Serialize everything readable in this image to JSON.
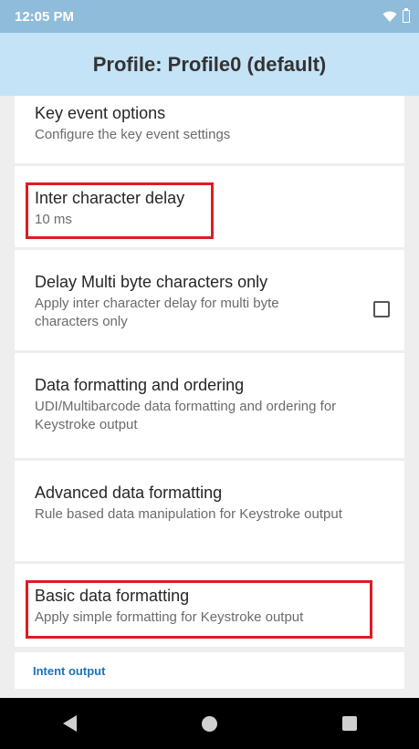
{
  "status_bar": {
    "time": "12:05 PM",
    "icons": [
      "wifi-icon",
      "battery-icon"
    ]
  },
  "app_bar": {
    "title": "Profile: Profile0 (default)"
  },
  "settings": {
    "items": [
      {
        "title": "Key event options",
        "subtitle": "Configure the key event settings"
      },
      {
        "title": "Inter character delay",
        "subtitle": "10 ms"
      },
      {
        "title": "Delay Multi byte characters only",
        "subtitle": "Apply inter character delay for multi byte characters only",
        "checked": false
      },
      {
        "title": "Data formatting and ordering",
        "subtitle": "UDI/Multibarcode data formatting and ordering for Keystroke output"
      },
      {
        "title": "Advanced data formatting",
        "subtitle": "Rule based data manipulation for Keystroke output"
      },
      {
        "title": "Basic data formatting",
        "subtitle": "Apply simple formatting for Keystroke output"
      }
    ],
    "section_header": "Intent output"
  },
  "colors": {
    "status_bar": "#8fbcd9",
    "app_bar": "#c5e3f6",
    "highlight": "#e01b24",
    "section_header": "#1a73b8"
  },
  "nav_bar": {
    "icons": [
      "back-icon",
      "home-icon",
      "recents-icon"
    ]
  }
}
